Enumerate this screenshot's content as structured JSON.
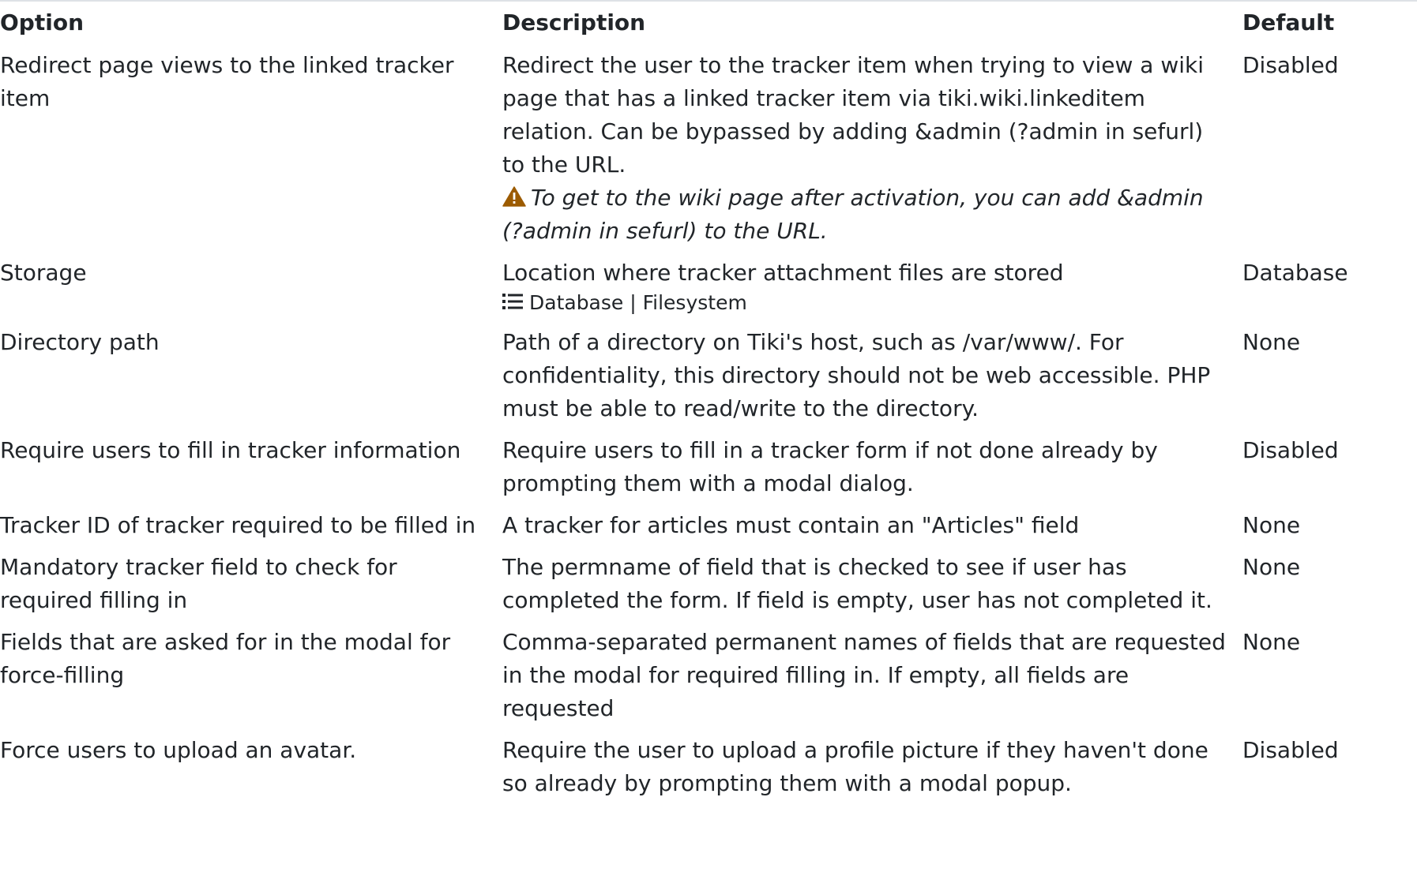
{
  "table": {
    "headers": {
      "option": "Option",
      "description": "Description",
      "default": "Default"
    },
    "rows": [
      {
        "option": "Redirect page views to the linked tracker item",
        "description": "Redirect the user to the tracker item when trying to view a wiki page that has a linked tracker item via tiki.wiki.linkeditem relation. Can be bypassed by adding &admin (?admin in sefurl) to the URL.",
        "note": "To get to the wiki page after activation, you can add &admin (?admin in sefurl) to the URL.",
        "note_icon": "warning-icon",
        "default": "Disabled"
      },
      {
        "option": "Storage",
        "description": "Location where tracker attachment files are stored",
        "options_icon": "list-icon",
        "options_text": "Database | Filesystem",
        "default": "Database"
      },
      {
        "option": "Directory path",
        "description": "Path of a directory on Tiki's host, such as /var/www/. For confidentiality, this directory should not be web accessible. PHP must be able to read/write to the directory.",
        "default": "None"
      },
      {
        "option": "Require users to fill in tracker information",
        "description": "Require users to fill in a tracker form if not done already by prompting them with a modal dialog.",
        "default": "Disabled"
      },
      {
        "option": "Tracker ID of tracker required to be filled in",
        "description": "A tracker for articles must contain an \"Articles\" field",
        "default": "None"
      },
      {
        "option": "Mandatory tracker field to check for required filling in",
        "description": "The permname of field that is checked to see if user has completed the form. If field is empty, user has not completed it.",
        "default": "None"
      },
      {
        "option": "Fields that are asked for in the modal for force-filling",
        "description": "Comma-separated permanent names of fields that are requested in the modal for required filling in. If empty, all fields are requested",
        "default": "None"
      },
      {
        "option": "Force users to upload an avatar.",
        "description": "Require the user to upload a profile picture if they haven't done so already by prompting them with a modal popup.",
        "default": "Disabled"
      }
    ]
  },
  "colors": {
    "text": "#212529",
    "warning_icon": "#9c5b00",
    "border": "#dee2e6"
  }
}
